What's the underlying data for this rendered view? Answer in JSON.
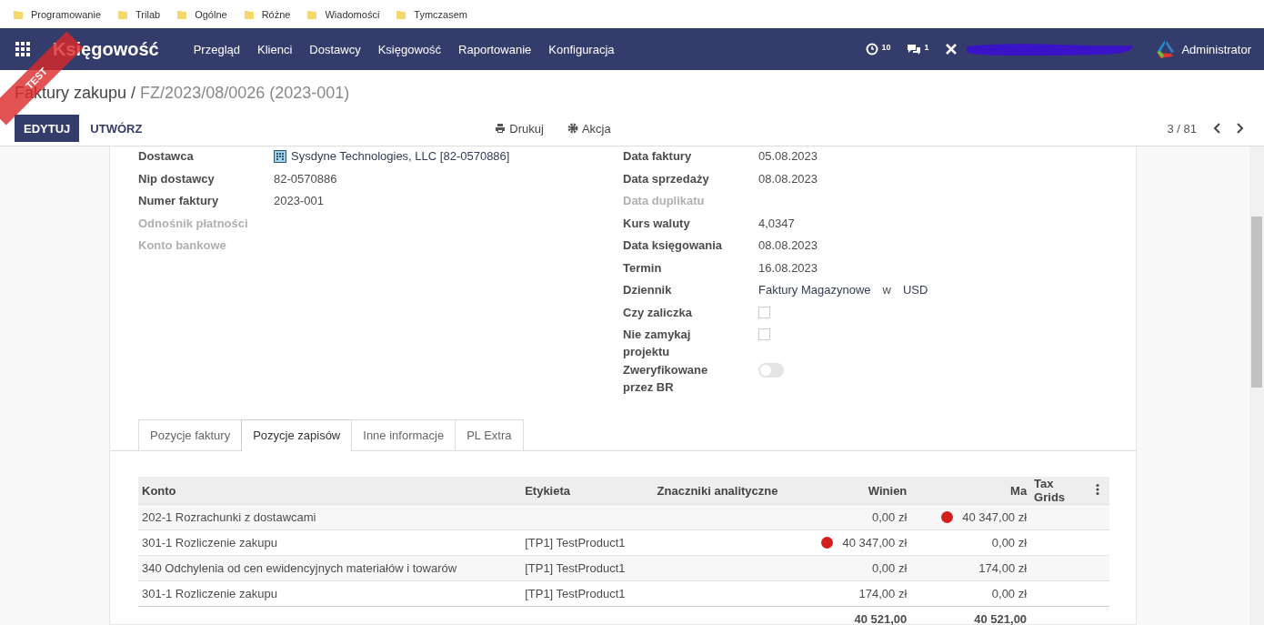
{
  "bookmarks": [
    {
      "label": "Programowanie"
    },
    {
      "label": "Trilab"
    },
    {
      "label": "Ogólne"
    },
    {
      "label": "Różne"
    },
    {
      "label": "Wiadomości"
    },
    {
      "label": "Tymczasem"
    }
  ],
  "navbar": {
    "app_title": "Księgowość",
    "menu": [
      "Przegląd",
      "Klienci",
      "Dostawcy",
      "Księgowość",
      "Raportowanie",
      "Konfiguracja"
    ],
    "activity_count": "10",
    "message_count": "1",
    "user": "Administrator"
  },
  "ribbon": {
    "label": "TEST"
  },
  "breadcrumb": {
    "parent": "Faktury zakupu",
    "separator": "/",
    "current": "FZ/2023/08/0026 (2023-001)"
  },
  "buttons": {
    "edit": "EDYTUJ",
    "create": "UTWÓRZ"
  },
  "actions": [
    {
      "label": "Drukuj",
      "kind": "print"
    },
    {
      "label": "Akcja",
      "kind": "gear"
    }
  ],
  "pager": {
    "counter": "3 / 81"
  },
  "left_fields": [
    {
      "label": "Dostawca",
      "kind": "partner",
      "value": "Sysdyne Technologies, LLC [82-0570886]",
      "muted": false
    },
    {
      "label": "Nip dostawcy",
      "kind": "text",
      "value": "82-0570886",
      "muted": false
    },
    {
      "label": "Numer faktury",
      "kind": "text",
      "value": "2023-001",
      "muted": false
    },
    {
      "label": "Odnośnik płatności",
      "kind": "empty",
      "muted": true
    },
    {
      "label": "Konto bankowe",
      "kind": "empty",
      "muted": true
    }
  ],
  "right_fields": [
    {
      "label": "Data faktury",
      "kind": "text",
      "value": "05.08.2023",
      "muted": false
    },
    {
      "label": "Data sprzedaży",
      "kind": "text",
      "value": "08.08.2023",
      "muted": false
    },
    {
      "label": "Data duplikatu",
      "kind": "empty",
      "muted": true
    },
    {
      "label": "Kurs waluty",
      "kind": "text",
      "value": "4,0347",
      "muted": false
    },
    {
      "label": "Data księgowania",
      "kind": "text",
      "value": "08.08.2023",
      "muted": false
    },
    {
      "label": "Termin",
      "kind": "text",
      "value": "16.08.2023",
      "muted": false
    },
    {
      "label": "Dziennik",
      "kind": "journal",
      "value": "Faktury Magazynowe",
      "joiner": "w",
      "currency": "USD",
      "muted": false
    },
    {
      "label": "Czy zaliczka",
      "kind": "checkbox",
      "checked": false,
      "muted": false
    },
    {
      "label": "Nie zamykaj projektu",
      "kind": "checkbox",
      "checked": false,
      "muted": false
    },
    {
      "label": "Zweryfikowane przez BR",
      "kind": "toggle",
      "on": false,
      "muted": false
    }
  ],
  "tabs": [
    {
      "label": "Pozycje faktury",
      "selected": false
    },
    {
      "label": "Pozycje zapisów",
      "selected": true
    },
    {
      "label": "Inne informacje",
      "selected": false
    },
    {
      "label": "PL Extra",
      "selected": false
    }
  ],
  "table": {
    "columns": [
      "Konto",
      "Etykieta",
      "Znaczniki analityczne",
      "Winien",
      "Ma",
      "Tax Grids"
    ],
    "rows": [
      {
        "konto": "202-1 Rozrachunki z dostawcami",
        "winien": {
          "text": "0,00 zł",
          "dot": false
        },
        "ma": {
          "text": "40 347,00 zł",
          "dot": true
        }
      },
      {
        "konto": "301-1 Rozliczenie zakupu",
        "etykieta": "[TP1] TestProduct1",
        "winien": {
          "text": "40 347,00 zł",
          "dot": true
        },
        "ma": {
          "text": "0,00 zł",
          "dot": false
        }
      },
      {
        "konto": "340 Odchylenia od cen ewidencyjnych materiałów i towarów",
        "etykieta": "[TP1] TestProduct1",
        "winien": {
          "text": "0,00 zł",
          "dot": false
        },
        "ma": {
          "text": "174,00 zł",
          "dot": false
        }
      },
      {
        "konto": "301-1 Rozliczenie zakupu",
        "etykieta": "[TP1] TestProduct1",
        "winien": {
          "text": "174,00 zł",
          "dot": false
        },
        "ma": {
          "text": "0,00 zł",
          "dot": false
        }
      }
    ],
    "totals": {
      "winien": "40 521,00",
      "ma": "40 521,00"
    }
  }
}
